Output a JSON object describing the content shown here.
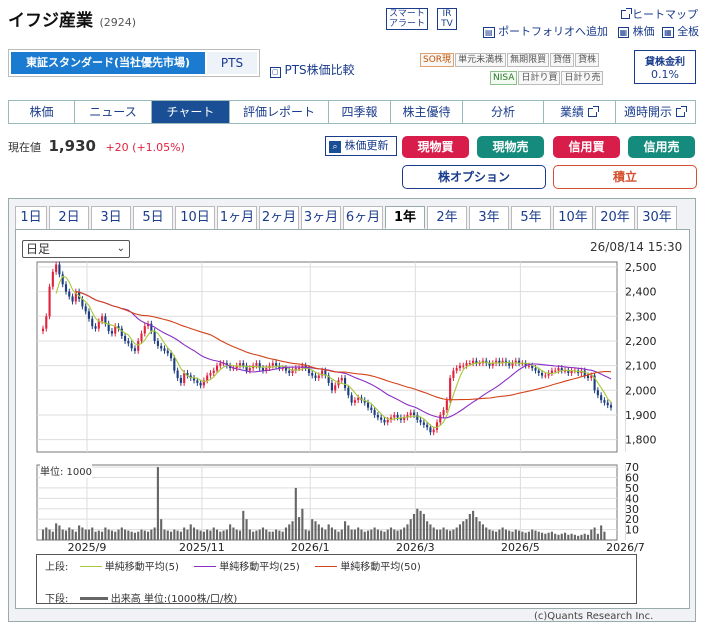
{
  "header": {
    "company": "イフジ産業",
    "code": "(2924)",
    "smart_alert": [
      "スマート",
      "アラート"
    ],
    "ir_tv": [
      "IR",
      "TV"
    ],
    "heatmap": "ヒートマップ",
    "portfolio_add": "ポートフォリオへ追加",
    "stock_price": "株価",
    "full_board": "全板"
  },
  "market": {
    "tab_tse": "東証スタンダード(当社優先市場)",
    "tab_pts": "PTS",
    "pts_compare": "PTS株価比較",
    "badges_row1": [
      "SOR現",
      "単元未満株",
      "無期限買",
      "貸借",
      "貸株"
    ],
    "badges_row2": [
      "NISA",
      "日計り買",
      "日計り売"
    ],
    "lending_label": "貸株金利",
    "lending_rate": "0.1%"
  },
  "nav": {
    "tabs": [
      "株価",
      "ニュース",
      "チャート",
      "評価レポート",
      "四季報",
      "株主優待",
      "分析"
    ],
    "active": "チャート",
    "right_links": [
      "業績",
      "適時開示"
    ]
  },
  "quote": {
    "label": "現在値",
    "price": "1,930",
    "change": "+20 (+1.05%)",
    "refresh": "株価更新",
    "buttons": [
      "現物買",
      "現物売",
      "信用買",
      "信用売"
    ],
    "option": "株オプション",
    "accumulate": "積立"
  },
  "ranges": {
    "tabs": [
      "1日",
      "2日",
      "3日",
      "5日",
      "10日",
      "1ヶ月",
      "2ヶ月",
      "3ヶ月",
      "6ヶ月",
      "1年",
      "2年",
      "3年",
      "5年",
      "10年",
      "20年",
      "30年"
    ],
    "active": "1年"
  },
  "chart_panel": {
    "period_select": "日足",
    "timestamp": "26/08/14 15:30",
    "volume_unit": "単位: 1000",
    "legend_upper_label": "上段:",
    "legend_lower_label": "下段:",
    "ma_legend": [
      "単純移動平均(5)",
      "単純移動平均(25)",
      "単純移動平均(50)"
    ],
    "volume_legend": "出来高 単位:(1000株/口/枚)",
    "credit": "(c)Quants Research Inc."
  },
  "colors": {
    "up": "#e0223f",
    "down": "#1c3d80",
    "ma5": "#a6c83a",
    "ma25": "#8a2fc4",
    "ma50": "#d2441a",
    "volume": "#666666"
  },
  "chart_data": {
    "type": "line",
    "price_axis": {
      "ylim": [
        1750,
        2520
      ],
      "ticks": [
        "2,500",
        "2,400",
        "2,300",
        "2,200",
        "2,100",
        "2,000",
        "1,900",
        "1,800"
      ]
    },
    "volume_axis": {
      "ylim": [
        0,
        72
      ],
      "ticks": [
        "70",
        "60",
        "50",
        "40",
        "30",
        "20",
        "10"
      ]
    },
    "x_ticks": [
      "2025/9",
      "2025/11",
      "2026/1",
      "2026/3",
      "2026/5",
      "2026/7"
    ],
    "close": [
      2250,
      2300,
      2420,
      2480,
      2510,
      2470,
      2430,
      2400,
      2380,
      2360,
      2400,
      2370,
      2340,
      2320,
      2290,
      2260,
      2250,
      2280,
      2300,
      2270,
      2240,
      2230,
      2260,
      2250,
      2220,
      2200,
      2190,
      2170,
      2160,
      2200,
      2230,
      2260,
      2270,
      2240,
      2200,
      2180,
      2170,
      2160,
      2150,
      2130,
      2080,
      2050,
      2030,
      2070,
      2060,
      2050,
      2040,
      2030,
      2020,
      2040,
      2060,
      2070,
      2080,
      2100,
      2110,
      2110,
      2100,
      2090,
      2090,
      2100,
      2110,
      2100,
      2080,
      2090,
      2100,
      2110,
      2090,
      2080,
      2090,
      2100,
      2110,
      2100,
      2090,
      2090,
      2080,
      2070,
      2080,
      2090,
      2090,
      2100,
      2090,
      2070,
      2060,
      2050,
      2060,
      2080,
      2060,
      2030,
      2000,
      2020,
      2040,
      2050,
      2010,
      1980,
      1950,
      1960,
      1970,
      1960,
      1950,
      1930,
      1920,
      1900,
      1890,
      1880,
      1870,
      1880,
      1890,
      1900,
      1890,
      1880,
      1890,
      1900,
      1910,
      1900,
      1880,
      1870,
      1860,
      1850,
      1830,
      1840,
      1870,
      1900,
      1920,
      1960,
      2050,
      2080,
      2090,
      2100,
      2100,
      2110,
      2110,
      2120,
      2110,
      2110,
      2120,
      2110,
      2100,
      2110,
      2120,
      2110,
      2120,
      2110,
      2100,
      2110,
      2120,
      2110,
      2110,
      2100,
      2100,
      2090,
      2080,
      2070,
      2060,
      2060,
      2070,
      2080,
      2080,
      2090,
      2080,
      2080,
      2070,
      2080,
      2080,
      2070,
      2080,
      2060,
      2050,
      2060,
      2000,
      1980,
      1960,
      1950,
      1940,
      1930
    ],
    "volume": [
      10,
      12,
      10,
      8,
      16,
      14,
      10,
      9,
      12,
      10,
      8,
      14,
      12,
      10,
      10,
      12,
      8,
      9,
      8,
      12,
      10,
      9,
      8,
      10,
      12,
      10,
      9,
      8,
      7,
      8,
      10,
      9,
      8,
      10,
      12,
      70,
      20,
      10,
      9,
      8,
      10,
      9,
      8,
      12,
      10,
      15,
      12,
      10,
      9,
      8,
      10,
      9,
      12,
      10,
      8,
      9,
      10,
      15,
      12,
      10,
      9,
      28,
      20,
      10,
      8,
      9,
      10,
      12,
      10,
      8,
      8,
      10,
      9,
      8,
      12,
      15,
      18,
      50,
      22,
      30,
      10,
      9,
      20,
      18,
      15,
      12,
      10,
      15,
      12,
      10,
      8,
      10,
      18,
      14,
      10,
      10,
      12,
      10,
      8,
      9,
      10,
      12,
      10,
      9,
      8,
      10,
      12,
      10,
      9,
      10,
      12,
      15,
      20,
      25,
      30,
      28,
      25,
      18,
      15,
      12,
      10,
      10,
      12,
      10,
      9,
      10,
      12,
      15,
      18,
      20,
      25,
      28,
      22,
      18,
      15,
      12,
      10,
      9,
      8,
      10,
      12,
      10,
      9,
      8,
      10,
      9,
      8,
      7,
      8,
      10,
      9,
      8,
      7,
      6,
      7,
      8,
      6,
      5,
      6,
      7,
      5,
      6,
      5,
      4,
      5,
      6,
      5,
      10,
      12,
      6,
      14,
      8
    ]
  }
}
